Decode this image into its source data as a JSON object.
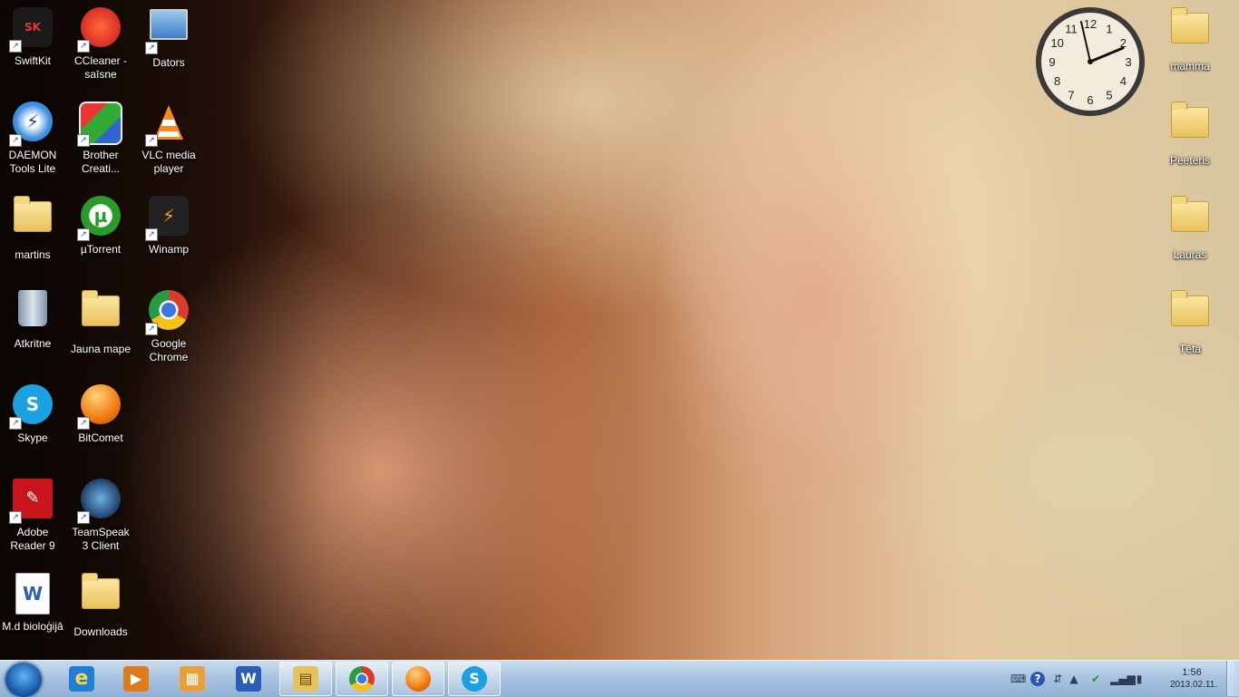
{
  "desktop": {
    "left_icons": [
      {
        "label": "SwiftKit",
        "icon": "swiftkit-icon",
        "badge": "SK"
      },
      {
        "label": "CCleaner - saīsne",
        "icon": "ccleaner-icon"
      },
      {
        "label": "Dators",
        "icon": "computer-icon"
      },
      {
        "label": "DAEMON Tools Lite",
        "icon": "daemon-tools-icon"
      },
      {
        "label": "Brother Creati...",
        "icon": "brother-icon"
      },
      {
        "label": "VLC media player",
        "icon": "vlc-icon"
      },
      {
        "label": "martins",
        "icon": "user-folder-icon"
      },
      {
        "label": "µTorrent",
        "icon": "utorrent-icon",
        "badge": "µ"
      },
      {
        "label": "Winamp",
        "icon": "winamp-icon"
      },
      {
        "label": "Atkritne",
        "icon": "recycle-bin-icon"
      },
      {
        "label": "Jauna mape",
        "icon": "folder-icon"
      },
      {
        "label": "Google Chrome",
        "icon": "chrome-icon"
      },
      {
        "label": "Skype",
        "icon": "skype-icon",
        "badge": "S"
      },
      {
        "label": "BitComet",
        "icon": "bitcomet-icon"
      },
      {
        "label": "Adobe Reader 9",
        "icon": "adobe-reader-icon"
      },
      {
        "label": "TeamSpeak 3 Client",
        "icon": "teamspeak-icon"
      },
      {
        "label": "M.d bioloģijā",
        "icon": "word-document-icon",
        "badge": "W"
      },
      {
        "label": "Downloads",
        "icon": "downloads-folder-icon"
      }
    ],
    "right_icons": [
      {
        "label": "mamma",
        "icon": "folder-icon"
      },
      {
        "label": "Peeteris",
        "icon": "folder-icon"
      },
      {
        "label": "Lauras",
        "icon": "folder-icon"
      },
      {
        "label": "Tēta",
        "icon": "folder-icon"
      }
    ],
    "clock_gadget": {
      "numbers": [
        "12",
        "1",
        "2",
        "3",
        "4",
        "5",
        "6",
        "7",
        "8",
        "9",
        "10",
        "11"
      ],
      "time": "1:56"
    }
  },
  "taskbar": {
    "start_icon": "windows-start-icon",
    "pinned": [
      {
        "name": "internet-explorer",
        "icon": "ie-icon",
        "color": "#1f7fd6",
        "glyph": "e"
      },
      {
        "name": "windows-media-player",
        "icon": "media-player-icon",
        "color": "#e07b1b",
        "glyph": "▶"
      },
      {
        "name": "paint",
        "icon": "paint-icon",
        "color": "#e8a13a",
        "glyph": "▦"
      },
      {
        "name": "word",
        "icon": "word-icon",
        "color": "#2b5db6",
        "glyph": "W"
      },
      {
        "name": "explorer",
        "icon": "explorer-icon",
        "color": "#e6c25c",
        "glyph": "▤",
        "active": true
      },
      {
        "name": "chrome",
        "icon": "chrome-icon",
        "color": "#d93c2e",
        "glyph": "●",
        "active": true
      },
      {
        "name": "bitcomet",
        "icon": "bitcomet-icon",
        "color": "#f08a1e",
        "glyph": "≋",
        "active": true
      },
      {
        "name": "skype",
        "icon": "skype-icon",
        "color": "#1ba1e2",
        "glyph": "S",
        "active": true
      }
    ],
    "tray": {
      "time": "1:56",
      "date": "2013.02.11."
    }
  },
  "colors": {
    "taskbar": "#a9c4e0",
    "label_text": "#ffffff"
  }
}
